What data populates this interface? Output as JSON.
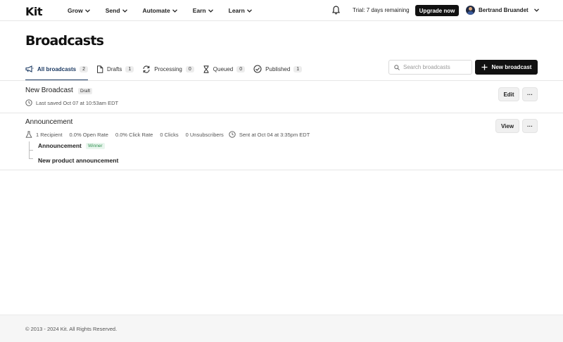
{
  "nav": {
    "logo": "Kit",
    "items": [
      {
        "label": "Grow"
      },
      {
        "label": "Send"
      },
      {
        "label": "Automate"
      },
      {
        "label": "Earn"
      },
      {
        "label": "Learn"
      }
    ],
    "trial": "Trial: 7 days remaining",
    "upgrade": "Upgrade now",
    "user_name": "Bertrand Bruandet"
  },
  "page": {
    "title": "Broadcasts",
    "search_placeholder": "Search broadcasts",
    "new_button": "New broadcast"
  },
  "tabs": [
    {
      "label": "All broadcasts",
      "count": "2",
      "icon": "megaphone-icon",
      "active": true
    },
    {
      "label": "Drafts",
      "count": "1",
      "icon": "document-icon"
    },
    {
      "label": "Processing",
      "count": "0",
      "icon": "refresh-icon"
    },
    {
      "label": "Queued",
      "count": "0",
      "icon": "hourglass-icon"
    },
    {
      "label": "Published",
      "count": "1",
      "icon": "check-circle-icon"
    }
  ],
  "broadcasts": [
    {
      "title": "New Broadcast",
      "badge": "Draft",
      "meta": "Last saved Oct 07 at 10:53am EDT",
      "action": "Edit",
      "more": "···"
    },
    {
      "title": "Announcement",
      "recipients": "1 Recipient",
      "open_rate": "0.0% Open Rate",
      "click_rate": "0.0% Click Rate",
      "clicks": "0 Clicks",
      "unsubscribers": "0 Unsubscribers",
      "sent": "Sent at Oct 04 at 3:35pm EDT",
      "action": "View",
      "more": "···",
      "variants": [
        {
          "subject": "Announcement",
          "badge": "Winner"
        },
        {
          "subject": "New product announcement"
        }
      ]
    }
  ],
  "footer": {
    "copyright": "© 2013 - 2024 Kit. All Rights Reserved."
  },
  "colors": {
    "accent": "#1c3a63",
    "primary_button": "#111111",
    "winner": "#2f8f4e"
  }
}
